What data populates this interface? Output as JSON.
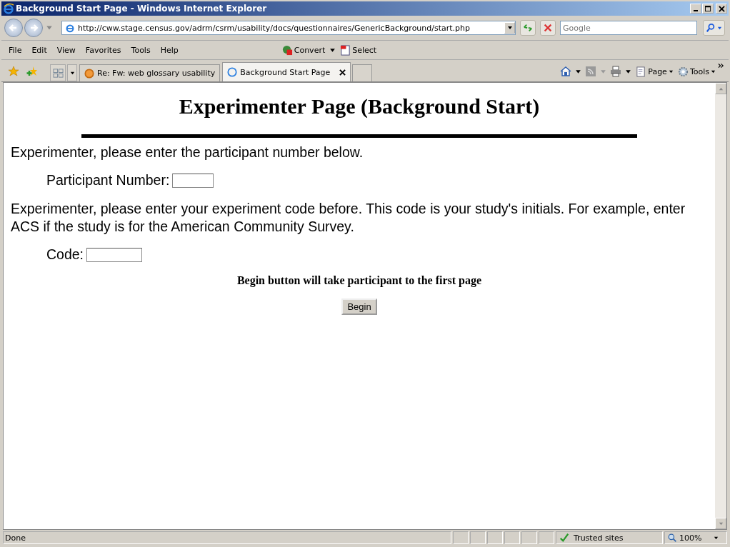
{
  "window": {
    "title": "Background Start Page - Windows Internet Explorer"
  },
  "address": {
    "url": "http://cww.stage.census.gov/adrm/csrm/usability/docs/questionnaires/GenericBackground/start.php"
  },
  "search": {
    "placeholder": "Google"
  },
  "menu": [
    "File",
    "Edit",
    "View",
    "Favorites",
    "Tools",
    "Help"
  ],
  "toolbar": [
    "Convert",
    "Select"
  ],
  "tabs": [
    {
      "label": "Re: Fw: web glossary usability",
      "selected": false
    },
    {
      "label": "Background Start Page",
      "selected": true
    }
  ],
  "command_bar": [
    "Page",
    "Tools"
  ],
  "page": {
    "heading": "Experimenter Page (Background Start)",
    "intro_1": "Experimenter, please enter the participant number below.",
    "participant_label": "Participant Number:",
    "intro_2": "Experimenter, please enter your experiment code before. This code is your study's initials. For example, enter ACS if the study is for the American Community Survey.",
    "code_label": "Code:",
    "note": "Begin button will take participant to the first page",
    "button": "Begin"
  },
  "status_bar": {
    "status": "Done",
    "zone": "Trusted sites",
    "zoom": "100%"
  }
}
